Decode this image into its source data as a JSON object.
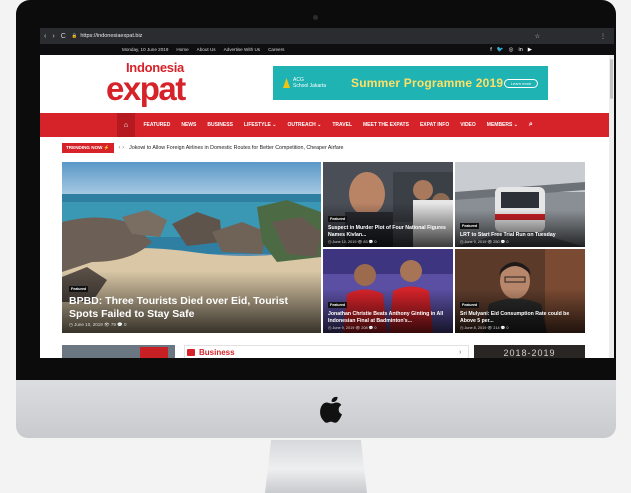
{
  "browser": {
    "url": "https://indonesiaexpat.biz",
    "back": "‹",
    "forward": "›",
    "reload": "C",
    "lock": "🔒",
    "star": "☆",
    "menu": "⋮"
  },
  "topbar": {
    "date": "Monday, 10 June 2019",
    "links": [
      "Home",
      "About Us",
      "Advertise With Us",
      "Careers"
    ],
    "social": [
      "f",
      "🐦",
      "◎",
      "in",
      "▶"
    ]
  },
  "brand": {
    "small": "Indonesia",
    "large": "expat"
  },
  "ad": {
    "sponsor_line1": "ACG",
    "sponsor_line2": "School Jakarta",
    "title": "Summer Programme 2019",
    "button": "Learn more",
    "color": "#1fb3b3",
    "title_color": "#ffe066"
  },
  "nav": {
    "home_icon": "⌂",
    "items": [
      "FEATURED",
      "NEWS",
      "BUSINESS",
      "LIFESTYLE ⌄",
      "OUTREACH ⌄",
      "TRAVEL",
      "MEET THE EXPATS",
      "EXPAT INFO",
      "VIDEO",
      "MEMBERS ⌄"
    ],
    "search_icon": "⌕",
    "color": "#d6232a"
  },
  "trending": {
    "label": "TRENDING NOW ⚡",
    "arrows": "‹ ›",
    "headline": "Jokowi to Allow Foreign Airlines in Domestic Routes for Better Competition, Cheaper Airfare"
  },
  "featured": {
    "main": {
      "badge": "Featured",
      "title": "BPBD: Three Tourists Died over Eid, Tourist Spots Failed to Stay Safe",
      "meta": "◷ June 10, 2019  👁 79  💬 0"
    },
    "tiles": [
      {
        "badge": "Featured",
        "title": "Suspect in Murder Plot of Four National Figures Names Kivlan...",
        "meta": "◷ June 10, 2019  👁 83  💬 0"
      },
      {
        "badge": "Featured",
        "title": "LRT to Start Free Trial Run on Tuesday",
        "meta": "◷ June 9, 2019  👁 250  💬 0"
      },
      {
        "badge": "Featured",
        "title": "Jonathan Christie Beats Anthony Ginting in All Indonesian Final at Badminton's...",
        "meta": "◷ June 9, 2019  👁 208  💬 0"
      },
      {
        "badge": "Featured",
        "title": "Sri Mulyani: Eid Consumption Rate could be Above 5 per...",
        "meta": "◷ June 8, 2019  👁 214  💬 0"
      }
    ]
  },
  "bottom": {
    "section_title": "Business",
    "next_arrow": "›",
    "years": "2018-2019"
  }
}
